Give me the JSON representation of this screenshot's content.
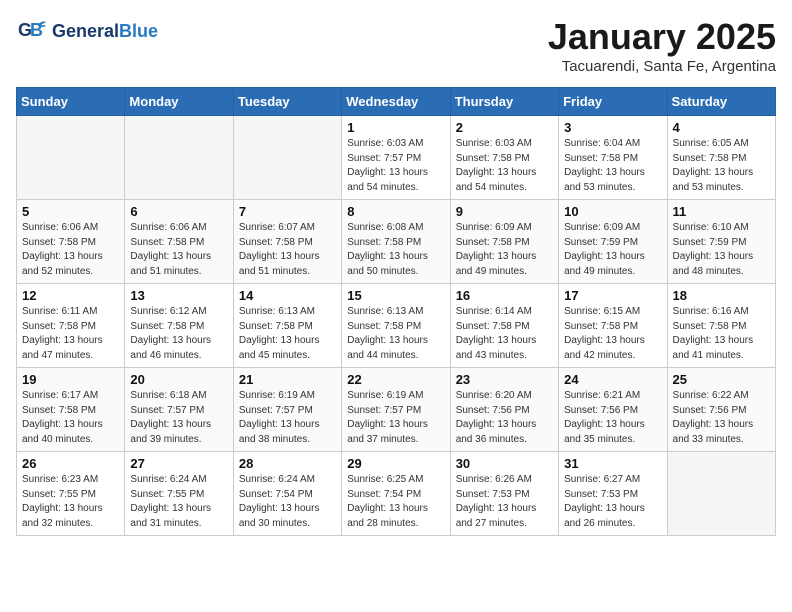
{
  "header": {
    "logo_general": "General",
    "logo_blue": "Blue",
    "month": "January 2025",
    "location": "Tacuarendi, Santa Fe, Argentina"
  },
  "weekdays": [
    "Sunday",
    "Monday",
    "Tuesday",
    "Wednesday",
    "Thursday",
    "Friday",
    "Saturday"
  ],
  "weeks": [
    [
      {
        "day": "",
        "empty": true
      },
      {
        "day": "",
        "empty": true
      },
      {
        "day": "",
        "empty": true
      },
      {
        "day": "1",
        "sunrise": "6:03 AM",
        "sunset": "7:57 PM",
        "daylight": "13 hours and 54 minutes."
      },
      {
        "day": "2",
        "sunrise": "6:03 AM",
        "sunset": "7:58 PM",
        "daylight": "13 hours and 54 minutes."
      },
      {
        "day": "3",
        "sunrise": "6:04 AM",
        "sunset": "7:58 PM",
        "daylight": "13 hours and 53 minutes."
      },
      {
        "day": "4",
        "sunrise": "6:05 AM",
        "sunset": "7:58 PM",
        "daylight": "13 hours and 53 minutes."
      }
    ],
    [
      {
        "day": "5",
        "sunrise": "6:06 AM",
        "sunset": "7:58 PM",
        "daylight": "13 hours and 52 minutes."
      },
      {
        "day": "6",
        "sunrise": "6:06 AM",
        "sunset": "7:58 PM",
        "daylight": "13 hours and 51 minutes."
      },
      {
        "day": "7",
        "sunrise": "6:07 AM",
        "sunset": "7:58 PM",
        "daylight": "13 hours and 51 minutes."
      },
      {
        "day": "8",
        "sunrise": "6:08 AM",
        "sunset": "7:58 PM",
        "daylight": "13 hours and 50 minutes."
      },
      {
        "day": "9",
        "sunrise": "6:09 AM",
        "sunset": "7:58 PM",
        "daylight": "13 hours and 49 minutes."
      },
      {
        "day": "10",
        "sunrise": "6:09 AM",
        "sunset": "7:59 PM",
        "daylight": "13 hours and 49 minutes."
      },
      {
        "day": "11",
        "sunrise": "6:10 AM",
        "sunset": "7:59 PM",
        "daylight": "13 hours and 48 minutes."
      }
    ],
    [
      {
        "day": "12",
        "sunrise": "6:11 AM",
        "sunset": "7:58 PM",
        "daylight": "13 hours and 47 minutes."
      },
      {
        "day": "13",
        "sunrise": "6:12 AM",
        "sunset": "7:58 PM",
        "daylight": "13 hours and 46 minutes."
      },
      {
        "day": "14",
        "sunrise": "6:13 AM",
        "sunset": "7:58 PM",
        "daylight": "13 hours and 45 minutes."
      },
      {
        "day": "15",
        "sunrise": "6:13 AM",
        "sunset": "7:58 PM",
        "daylight": "13 hours and 44 minutes."
      },
      {
        "day": "16",
        "sunrise": "6:14 AM",
        "sunset": "7:58 PM",
        "daylight": "13 hours and 43 minutes."
      },
      {
        "day": "17",
        "sunrise": "6:15 AM",
        "sunset": "7:58 PM",
        "daylight": "13 hours and 42 minutes."
      },
      {
        "day": "18",
        "sunrise": "6:16 AM",
        "sunset": "7:58 PM",
        "daylight": "13 hours and 41 minutes."
      }
    ],
    [
      {
        "day": "19",
        "sunrise": "6:17 AM",
        "sunset": "7:58 PM",
        "daylight": "13 hours and 40 minutes."
      },
      {
        "day": "20",
        "sunrise": "6:18 AM",
        "sunset": "7:57 PM",
        "daylight": "13 hours and 39 minutes."
      },
      {
        "day": "21",
        "sunrise": "6:19 AM",
        "sunset": "7:57 PM",
        "daylight": "13 hours and 38 minutes."
      },
      {
        "day": "22",
        "sunrise": "6:19 AM",
        "sunset": "7:57 PM",
        "daylight": "13 hours and 37 minutes."
      },
      {
        "day": "23",
        "sunrise": "6:20 AM",
        "sunset": "7:56 PM",
        "daylight": "13 hours and 36 minutes."
      },
      {
        "day": "24",
        "sunrise": "6:21 AM",
        "sunset": "7:56 PM",
        "daylight": "13 hours and 35 minutes."
      },
      {
        "day": "25",
        "sunrise": "6:22 AM",
        "sunset": "7:56 PM",
        "daylight": "13 hours and 33 minutes."
      }
    ],
    [
      {
        "day": "26",
        "sunrise": "6:23 AM",
        "sunset": "7:55 PM",
        "daylight": "13 hours and 32 minutes."
      },
      {
        "day": "27",
        "sunrise": "6:24 AM",
        "sunset": "7:55 PM",
        "daylight": "13 hours and 31 minutes."
      },
      {
        "day": "28",
        "sunrise": "6:24 AM",
        "sunset": "7:54 PM",
        "daylight": "13 hours and 30 minutes."
      },
      {
        "day": "29",
        "sunrise": "6:25 AM",
        "sunset": "7:54 PM",
        "daylight": "13 hours and 28 minutes."
      },
      {
        "day": "30",
        "sunrise": "6:26 AM",
        "sunset": "7:53 PM",
        "daylight": "13 hours and 27 minutes."
      },
      {
        "day": "31",
        "sunrise": "6:27 AM",
        "sunset": "7:53 PM",
        "daylight": "13 hours and 26 minutes."
      },
      {
        "day": "",
        "empty": true
      }
    ]
  ]
}
